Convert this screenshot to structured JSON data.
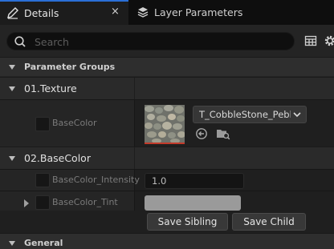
{
  "tabs": {
    "details": {
      "label": "Details",
      "close": "×",
      "icon": "pencil-icon"
    },
    "layers": {
      "label": "Layer Parameters",
      "icon": "layers-icon"
    }
  },
  "search": {
    "placeholder": "Search",
    "value": ""
  },
  "toolbar": {
    "table_icon": "table-view-icon",
    "settings_icon": "gear-icon"
  },
  "categories": {
    "parameter_groups": "Parameter Groups",
    "general": "General"
  },
  "groups": {
    "texture": {
      "label": "01.Texture",
      "params": {
        "base_color": {
          "name": "BaseColor",
          "asset": "T_CobbleStone_Pebble",
          "accent_color": "#c23a2a"
        }
      }
    },
    "basecolor": {
      "label": "02.BaseColor",
      "params": {
        "intensity": {
          "name": "BaseColor_Intensity",
          "value": "1.0"
        },
        "tint": {
          "name": "BaseColor_Tint",
          "color": "#9a9a9a"
        }
      }
    }
  },
  "buttons": {
    "save_sibling": "Save Sibling",
    "save_child": "Save Child"
  },
  "colors": {
    "accent": "#2a6fd6",
    "panel": "#242424"
  }
}
